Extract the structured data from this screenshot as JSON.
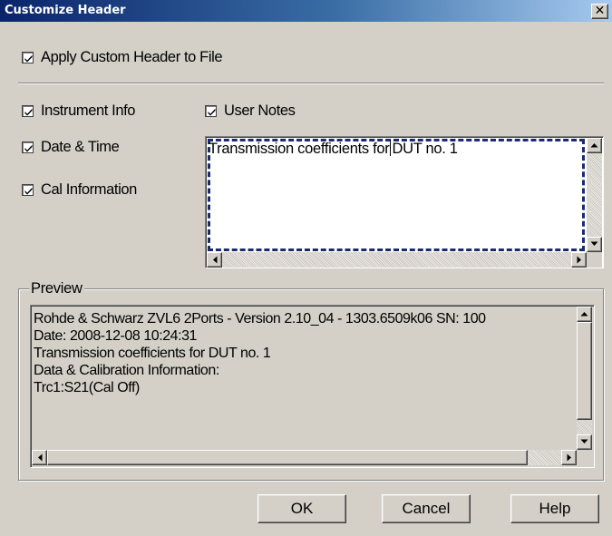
{
  "window": {
    "title": "Customize Header",
    "close_glyph": "✕"
  },
  "options": {
    "apply_custom_header": {
      "label": "Apply Custom Header to File",
      "checked": true
    },
    "instrument_info": {
      "label": "Instrument Info",
      "checked": true
    },
    "date_time": {
      "label": "Date & Time",
      "checked": true
    },
    "cal_information": {
      "label": "Cal Information",
      "checked": true
    },
    "user_notes": {
      "label": "User Notes",
      "checked": true
    }
  },
  "notes": {
    "before_caret": "Transmission coefficients for",
    "after_caret": "DUT no. 1"
  },
  "preview": {
    "legend": "Preview",
    "lines": [
      "Rohde & Schwarz ZVL6 2Ports - Version 2.10_04 - 1303.6509k06 SN: 100",
      "Date: 2008-12-08 10:24:31",
      "Transmission coefficients for DUT no. 1",
      "Data & Calibration Information:",
      "Trc1:S21(Cal Off)"
    ]
  },
  "buttons": {
    "ok": "OK",
    "cancel": "Cancel",
    "help": "Help"
  },
  "icons": {
    "checkmark": "checkmark-icon",
    "scroll_up": "scroll-up-arrow-icon",
    "scroll_down": "scroll-down-arrow-icon",
    "scroll_left": "scroll-left-arrow-icon",
    "scroll_right": "scroll-right-arrow-icon",
    "close": "close-icon"
  },
  "colors": {
    "dialog_bg": "#d4d0c8",
    "title_start": "#0a246a",
    "title_end": "#a6caf0",
    "focus_border": "#1a2a6c"
  }
}
